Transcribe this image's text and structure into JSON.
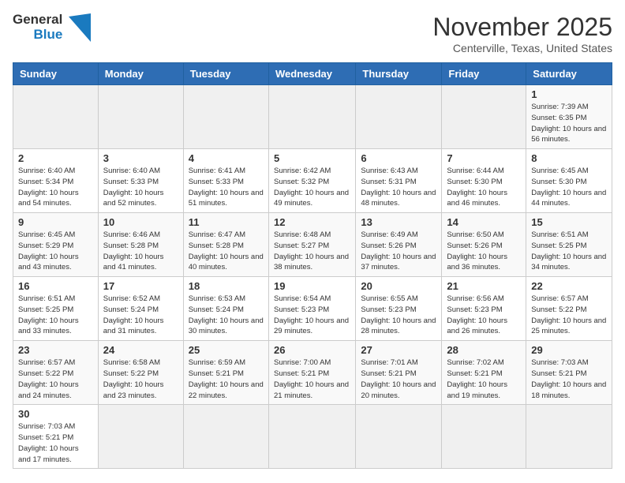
{
  "header": {
    "logo_line1": "General",
    "logo_line2": "Blue",
    "month_title": "November 2025",
    "location": "Centerville, Texas, United States"
  },
  "days_of_week": [
    "Sunday",
    "Monday",
    "Tuesday",
    "Wednesday",
    "Thursday",
    "Friday",
    "Saturday"
  ],
  "weeks": [
    [
      {
        "day": "",
        "info": ""
      },
      {
        "day": "",
        "info": ""
      },
      {
        "day": "",
        "info": ""
      },
      {
        "day": "",
        "info": ""
      },
      {
        "day": "",
        "info": ""
      },
      {
        "day": "",
        "info": ""
      },
      {
        "day": "1",
        "info": "Sunrise: 7:39 AM\nSunset: 6:35 PM\nDaylight: 10 hours and 56 minutes."
      }
    ],
    [
      {
        "day": "2",
        "info": "Sunrise: 6:40 AM\nSunset: 5:34 PM\nDaylight: 10 hours and 54 minutes."
      },
      {
        "day": "3",
        "info": "Sunrise: 6:40 AM\nSunset: 5:33 PM\nDaylight: 10 hours and 52 minutes."
      },
      {
        "day": "4",
        "info": "Sunrise: 6:41 AM\nSunset: 5:33 PM\nDaylight: 10 hours and 51 minutes."
      },
      {
        "day": "5",
        "info": "Sunrise: 6:42 AM\nSunset: 5:32 PM\nDaylight: 10 hours and 49 minutes."
      },
      {
        "day": "6",
        "info": "Sunrise: 6:43 AM\nSunset: 5:31 PM\nDaylight: 10 hours and 48 minutes."
      },
      {
        "day": "7",
        "info": "Sunrise: 6:44 AM\nSunset: 5:30 PM\nDaylight: 10 hours and 46 minutes."
      },
      {
        "day": "8",
        "info": "Sunrise: 6:45 AM\nSunset: 5:30 PM\nDaylight: 10 hours and 44 minutes."
      }
    ],
    [
      {
        "day": "9",
        "info": "Sunrise: 6:45 AM\nSunset: 5:29 PM\nDaylight: 10 hours and 43 minutes."
      },
      {
        "day": "10",
        "info": "Sunrise: 6:46 AM\nSunset: 5:28 PM\nDaylight: 10 hours and 41 minutes."
      },
      {
        "day": "11",
        "info": "Sunrise: 6:47 AM\nSunset: 5:28 PM\nDaylight: 10 hours and 40 minutes."
      },
      {
        "day": "12",
        "info": "Sunrise: 6:48 AM\nSunset: 5:27 PM\nDaylight: 10 hours and 38 minutes."
      },
      {
        "day": "13",
        "info": "Sunrise: 6:49 AM\nSunset: 5:26 PM\nDaylight: 10 hours and 37 minutes."
      },
      {
        "day": "14",
        "info": "Sunrise: 6:50 AM\nSunset: 5:26 PM\nDaylight: 10 hours and 36 minutes."
      },
      {
        "day": "15",
        "info": "Sunrise: 6:51 AM\nSunset: 5:25 PM\nDaylight: 10 hours and 34 minutes."
      }
    ],
    [
      {
        "day": "16",
        "info": "Sunrise: 6:51 AM\nSunset: 5:25 PM\nDaylight: 10 hours and 33 minutes."
      },
      {
        "day": "17",
        "info": "Sunrise: 6:52 AM\nSunset: 5:24 PM\nDaylight: 10 hours and 31 minutes."
      },
      {
        "day": "18",
        "info": "Sunrise: 6:53 AM\nSunset: 5:24 PM\nDaylight: 10 hours and 30 minutes."
      },
      {
        "day": "19",
        "info": "Sunrise: 6:54 AM\nSunset: 5:23 PM\nDaylight: 10 hours and 29 minutes."
      },
      {
        "day": "20",
        "info": "Sunrise: 6:55 AM\nSunset: 5:23 PM\nDaylight: 10 hours and 28 minutes."
      },
      {
        "day": "21",
        "info": "Sunrise: 6:56 AM\nSunset: 5:23 PM\nDaylight: 10 hours and 26 minutes."
      },
      {
        "day": "22",
        "info": "Sunrise: 6:57 AM\nSunset: 5:22 PM\nDaylight: 10 hours and 25 minutes."
      }
    ],
    [
      {
        "day": "23",
        "info": "Sunrise: 6:57 AM\nSunset: 5:22 PM\nDaylight: 10 hours and 24 minutes."
      },
      {
        "day": "24",
        "info": "Sunrise: 6:58 AM\nSunset: 5:22 PM\nDaylight: 10 hours and 23 minutes."
      },
      {
        "day": "25",
        "info": "Sunrise: 6:59 AM\nSunset: 5:21 PM\nDaylight: 10 hours and 22 minutes."
      },
      {
        "day": "26",
        "info": "Sunrise: 7:00 AM\nSunset: 5:21 PM\nDaylight: 10 hours and 21 minutes."
      },
      {
        "day": "27",
        "info": "Sunrise: 7:01 AM\nSunset: 5:21 PM\nDaylight: 10 hours and 20 minutes."
      },
      {
        "day": "28",
        "info": "Sunrise: 7:02 AM\nSunset: 5:21 PM\nDaylight: 10 hours and 19 minutes."
      },
      {
        "day": "29",
        "info": "Sunrise: 7:03 AM\nSunset: 5:21 PM\nDaylight: 10 hours and 18 minutes."
      }
    ],
    [
      {
        "day": "30",
        "info": "Sunrise: 7:03 AM\nSunset: 5:21 PM\nDaylight: 10 hours and 17 minutes."
      },
      {
        "day": "",
        "info": ""
      },
      {
        "day": "",
        "info": ""
      },
      {
        "day": "",
        "info": ""
      },
      {
        "day": "",
        "info": ""
      },
      {
        "day": "",
        "info": ""
      },
      {
        "day": "",
        "info": ""
      }
    ]
  ]
}
